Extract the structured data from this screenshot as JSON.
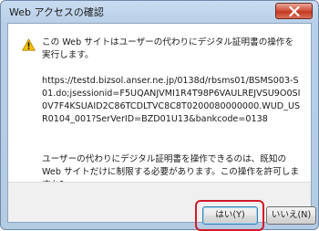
{
  "dialog": {
    "title": "Web アクセスの確認",
    "message_main": "この Web サイトはユーザーの代わりにデジタル証明書の操作を実行します。",
    "url": "https://testd.bizsol.anser.ne.jp/0138d/rbsms01/BSMS003-S01.do;jsessionid=F5UQANJVMI1R4T98P6VAULREJVSU9O0SI0V7F4KSUAID2C86TCDLTVC8C8T0200080000000.WUD_USR0104_001?SerVerID=BZD01U13&bankcode=0138",
    "message_body": "ユーザーの代わりにデジタル証明書を操作できるのは、既知の Web サイトだけに制限する必要があります。この操作を許可しますか?",
    "yes_label": "はい(Y)",
    "no_label": "いいえ(N)"
  },
  "icons": {
    "warning": "warning-icon",
    "close": "close-icon"
  },
  "colors": {
    "highlight": "#d21a2a",
    "close_button": "#c23a22",
    "titlebar": "#c9dcf0"
  }
}
